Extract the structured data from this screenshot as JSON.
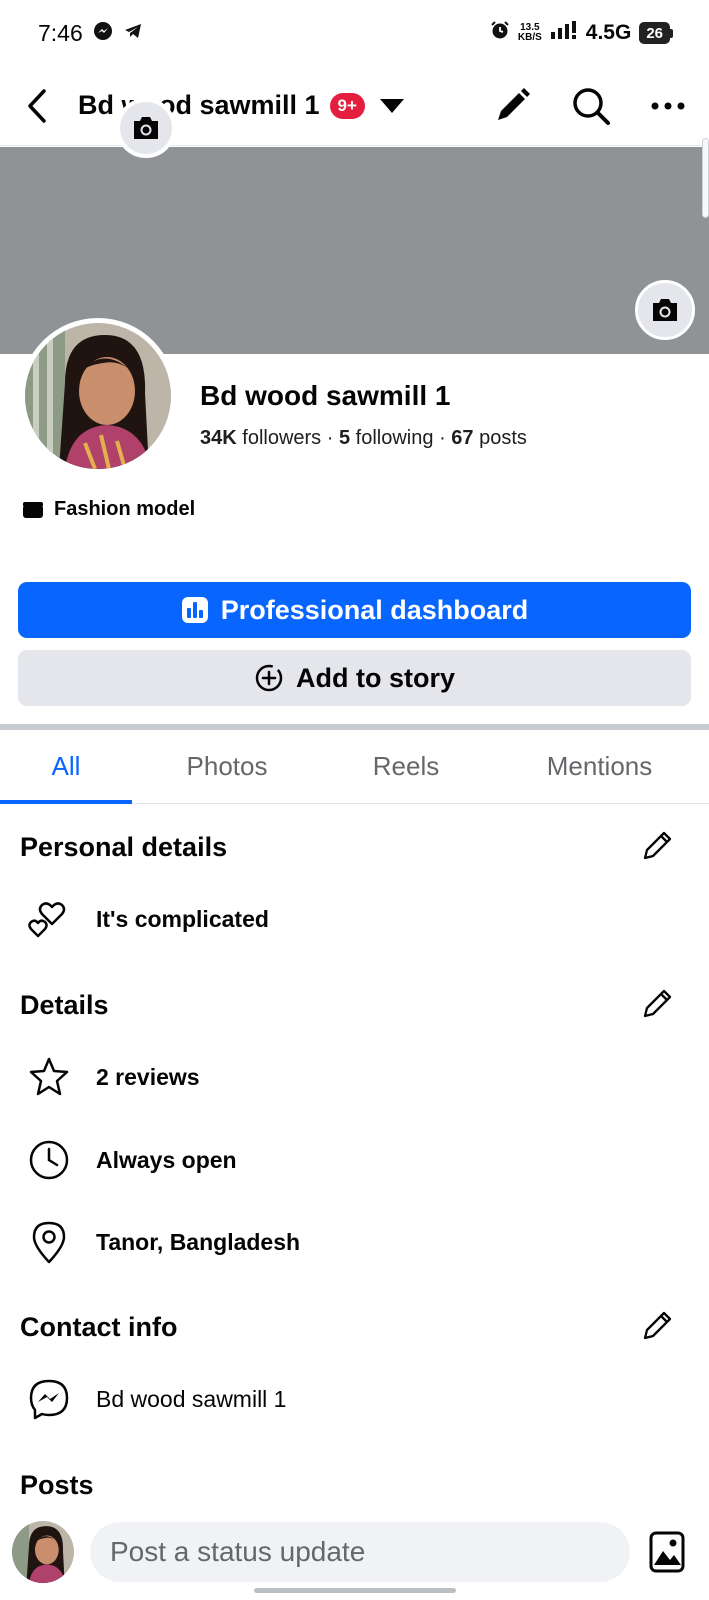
{
  "status_bar": {
    "time": "7:46",
    "net_speed_value": "13.5",
    "net_speed_unit": "KB/S",
    "network": "4.5G",
    "battery": "26",
    "icons": [
      "messenger-icon",
      "telegram-icon",
      "alarm-icon",
      "signal-icon"
    ]
  },
  "top_bar": {
    "title": "Bd wood sawmill 1",
    "badge": "9+",
    "icons": [
      "back-arrow-icon",
      "caret-down-icon",
      "pencil-icon",
      "search-icon",
      "more-icon"
    ]
  },
  "profile": {
    "name": "Bd wood sawmill 1",
    "followers_count": "34K",
    "followers_label": "followers",
    "following_count": "5",
    "following_label": "following",
    "posts_count": "67",
    "posts_label": "posts",
    "separator": "·",
    "category": "Fashion model"
  },
  "buttons": {
    "dashboard": "Professional dashboard",
    "add_story": "Add to story"
  },
  "tabs": [
    {
      "label": "All",
      "active": true
    },
    {
      "label": "Photos",
      "active": false
    },
    {
      "label": "Reels",
      "active": false
    },
    {
      "label": "Mentions",
      "active": false
    }
  ],
  "personal_details": {
    "title": "Personal details",
    "relationship": "It's complicated"
  },
  "details": {
    "title": "Details",
    "reviews": "2 reviews",
    "hours": "Always open",
    "location": "Tanor, Bangladesh"
  },
  "contact_info": {
    "title": "Contact info",
    "messenger": "Bd wood sawmill 1"
  },
  "posts": {
    "title": "Posts",
    "composer_placeholder": "Post a status update"
  },
  "colors": {
    "accent": "#0866ff",
    "badge": "#e41e3f",
    "cover": "#909396",
    "secondary_button": "#e4e6eb"
  }
}
